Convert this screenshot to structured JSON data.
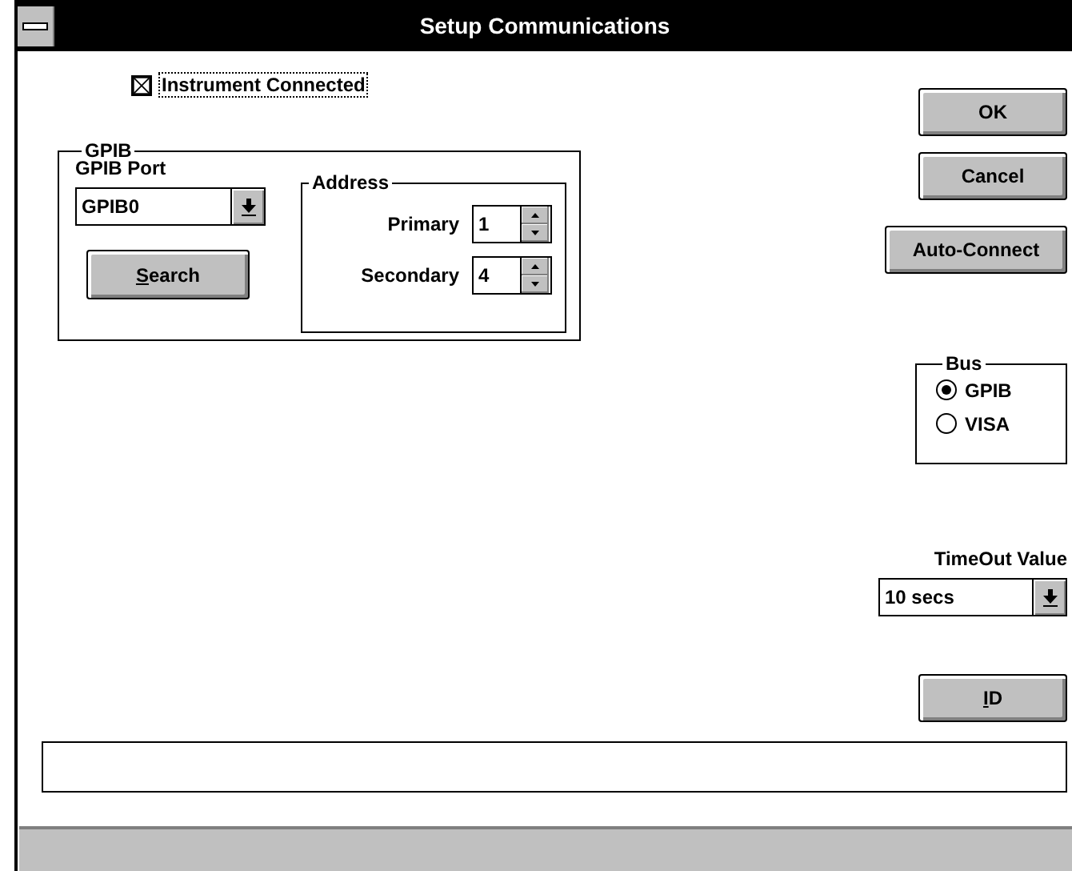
{
  "window": {
    "title": "Setup Communications"
  },
  "instrument_connected": {
    "label": "Instrument Connected",
    "checked": true,
    "focused": true
  },
  "gpib_group": {
    "title": "GPIB",
    "port_label": "GPIB Port",
    "port": {
      "value": "GPIB0"
    },
    "search_button": {
      "label": "Search",
      "mnemonic": true
    }
  },
  "address_group": {
    "title": "Address",
    "fields": [
      {
        "label": "Primary",
        "value": "1"
      },
      {
        "label": "Secondary",
        "value": "4"
      }
    ]
  },
  "buttons": [
    {
      "label": "OK",
      "mnemonic": false
    },
    {
      "label": "Cancel",
      "mnemonic": false
    },
    {
      "label": "Auto-Connect",
      "mnemonic": false
    }
  ],
  "bus_group": {
    "title": "Bus",
    "options": [
      {
        "label": "GPIB",
        "selected": true
      },
      {
        "label": "VISA",
        "selected": false
      }
    ]
  },
  "timeout": {
    "label": "TimeOut Value",
    "value": "10 secs"
  },
  "id_button": {
    "label": "ID",
    "mnemonic": true
  }
}
